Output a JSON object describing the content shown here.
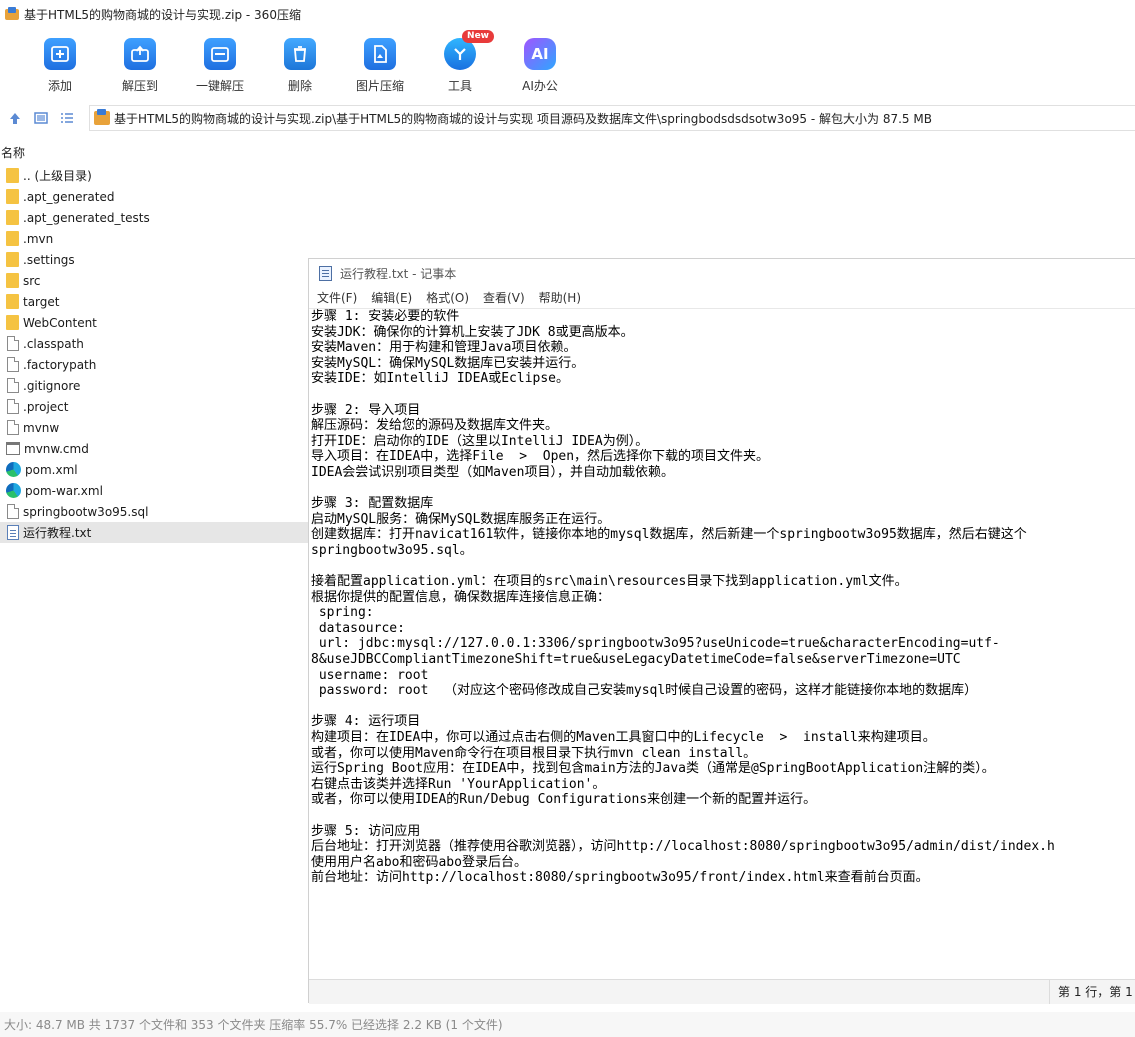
{
  "window": {
    "title": "基于HTML5的购物商城的设计与实现.zip - 360压缩"
  },
  "toolbar": {
    "items": [
      {
        "label": "添加",
        "icon": "add-icon"
      },
      {
        "label": "解压到",
        "icon": "extract-to-icon"
      },
      {
        "label": "一键解压",
        "icon": "one-click-extract-icon"
      },
      {
        "label": "删除",
        "icon": "delete-icon"
      },
      {
        "label": "图片压缩",
        "icon": "image-compress-icon"
      },
      {
        "label": "工具",
        "icon": "tools-icon",
        "badge": "New"
      },
      {
        "label": "AI办公",
        "icon": "ai-office-icon",
        "glyph": "AI"
      }
    ]
  },
  "pathbar": {
    "path": "基于HTML5的购物商城的设计与实现.zip\\基于HTML5的购物商城的设计与实现 项目源码及数据库文件\\springbodsdsdsotw3o95 - 解包大小为 87.5 MB"
  },
  "filelist": {
    "column_name": "名称",
    "files": [
      {
        "name": ".. (上级目录)",
        "type": "folder"
      },
      {
        "name": ".apt_generated",
        "type": "folder"
      },
      {
        "name": ".apt_generated_tests",
        "type": "folder"
      },
      {
        "name": ".mvn",
        "type": "folder"
      },
      {
        "name": ".settings",
        "type": "folder"
      },
      {
        "name": "src",
        "type": "folder"
      },
      {
        "name": "target",
        "type": "folder"
      },
      {
        "name": "WebContent",
        "type": "folder"
      },
      {
        "name": ".classpath",
        "type": "doc"
      },
      {
        "name": ".factorypath",
        "type": "doc"
      },
      {
        "name": ".gitignore",
        "type": "doc"
      },
      {
        "name": ".project",
        "type": "doc"
      },
      {
        "name": "mvnw",
        "type": "doc"
      },
      {
        "name": "mvnw.cmd",
        "type": "cmd"
      },
      {
        "name": "pom.xml",
        "type": "edge"
      },
      {
        "name": "pom-war.xml",
        "type": "edge"
      },
      {
        "name": "springbootw3o95.sql",
        "type": "doc"
      },
      {
        "name": "运行教程.txt",
        "type": "txt",
        "selected": true
      }
    ]
  },
  "statusbar": {
    "text": "大小: 48.7 MB 共 1737 个文件和 353 个文件夹 压缩率 55.7% 已经选择 2.2 KB (1 个文件)"
  },
  "notepad": {
    "title": "运行教程.txt - 记事本",
    "menu": [
      "文件(F)",
      "编辑(E)",
      "格式(O)",
      "查看(V)",
      "帮助(H)"
    ],
    "content": "步骤 1: 安装必要的软件\n安装JDK：确保你的计算机上安装了JDK 8或更高版本。\n安装Maven：用于构建和管理Java项目依赖。\n安装MySQL：确保MySQL数据库已安装并运行。\n安装IDE：如IntelliJ IDEA或Eclipse。\n\n步骤 2: 导入项目\n解压源码：发给您的源码及数据库文件夹。\n打开IDE：启动你的IDE（这里以IntelliJ IDEA为例）。\n导入项目：在IDEA中，选择File  >  Open，然后选择你下载的项目文件夹。\nIDEA会尝试识别项目类型（如Maven项目），并自动加载依赖。\n\n步骤 3: 配置数据库\n启动MySQL服务：确保MySQL数据库服务正在运行。\n创建数据库：打开navicat161软件，链接你本地的mysql数据库，然后新建一个springbootw3o95数据库，然后右键这个\nspringbootw3o95.sql。\n\n接着配置application.yml：在项目的src\\main\\resources目录下找到application.yml文件。\n根据你提供的配置信息，确保数据库连接信息正确：\n spring:\n datasource:\n url: jdbc:mysql://127.0.0.1:3306/springbootw3o95?useUnicode=true&characterEncoding=utf-\n8&useJDBCCompliantTimezoneShift=true&useLegacyDatetimeCode=false&serverTimezone=UTC\n username: root\n password: root  （对应这个密码修改成自己安装mysql时候自己设置的密码，这样才能链接你本地的数据库）\n\n步骤 4: 运行项目\n构建项目：在IDEA中，你可以通过点击右侧的Maven工具窗口中的Lifecycle  >  install来构建项目。\n或者，你可以使用Maven命令行在项目根目录下执行mvn clean install。\n运行Spring Boot应用：在IDEA中，找到包含main方法的Java类（通常是@SpringBootApplication注解的类）。\n右键点击该类并选择Run 'YourApplication'。\n或者，你可以使用IDEA的Run/Debug Configurations来创建一个新的配置并运行。\n\n步骤 5: 访问应用\n后台地址：打开浏览器（推荐使用谷歌浏览器），访问http://localhost:8080/springbootw3o95/admin/dist/index.h\n使用用户名abo和密码abo登录后台。\n前台地址：访问http://localhost:8080/springbootw3o95/front/index.html来查看前台页面。",
    "status": "第 1 行，第 1"
  }
}
